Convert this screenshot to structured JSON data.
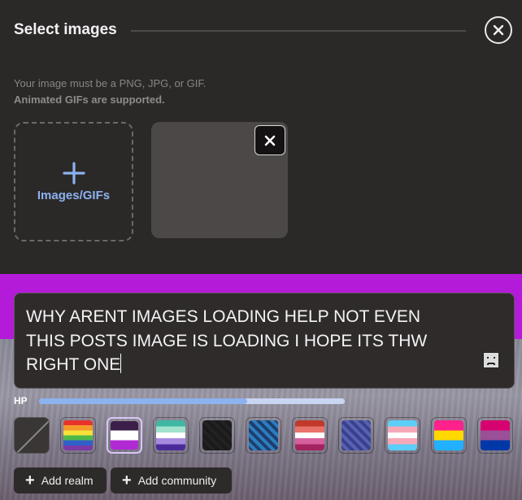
{
  "modal": {
    "title": "Select images",
    "hint_line1": "Your image must be a PNG, JPG, or GIF.",
    "hint_line2": "Animated GIFs are supported.",
    "upload_label": "Images/GIFs",
    "close_icon": "close-icon",
    "remove_icon": "close-icon"
  },
  "post": {
    "text": "WHY ARENT IMAGES LOADING HELP NOT EVEN\nTHIS POSTS IMAGE IS LOADING I HOPE ITS THW\nRIGHT ONE"
  },
  "hp": {
    "label": "HP",
    "fraction": 0.68
  },
  "themes": [
    {
      "name": "none"
    },
    {
      "name": "rainbow",
      "stripes": [
        "#e7332b",
        "#f39a2b",
        "#f6e23a",
        "#4fb848",
        "#3160c8",
        "#7b3aa6"
      ]
    },
    {
      "name": "purple-white",
      "stripes": [
        "#3b1f4a",
        "#ffffff",
        "#b02ad4"
      ]
    },
    {
      "name": "teal-lilac",
      "stripes": [
        "#3fb7a2",
        "#a2e2cf",
        "#ffffff",
        "#a68adf",
        "#4a2b9a"
      ]
    },
    {
      "name": "dark-pattern",
      "stripes": [
        "#222222",
        "#1a1a1a"
      ]
    },
    {
      "name": "blue-pattern",
      "stripes": [
        "#1e3e6e",
        "#2b7ec0"
      ]
    },
    {
      "name": "red-pink",
      "stripes": [
        "#c0392b",
        "#e8726a",
        "#ffffff",
        "#d65f9e",
        "#a3235e"
      ]
    },
    {
      "name": "circuit",
      "stripes": [
        "#3b3f8e",
        "#5563b0"
      ]
    },
    {
      "name": "trans",
      "stripes": [
        "#5bcefa",
        "#f5a9b8",
        "#ffffff",
        "#f5a9b8",
        "#5bcefa"
      ]
    },
    {
      "name": "pan",
      "stripes": [
        "#ff218c",
        "#ffd800",
        "#21b1ff"
      ]
    },
    {
      "name": "bi",
      "stripes": [
        "#d60270",
        "#9b4f96",
        "#0038a8"
      ]
    }
  ],
  "buttons": {
    "add_realm": "Add realm",
    "add_community": "Add community"
  },
  "colors": {
    "accent": "#8cb2ef",
    "band": "#b41bd8",
    "panel": "#2b2828"
  }
}
